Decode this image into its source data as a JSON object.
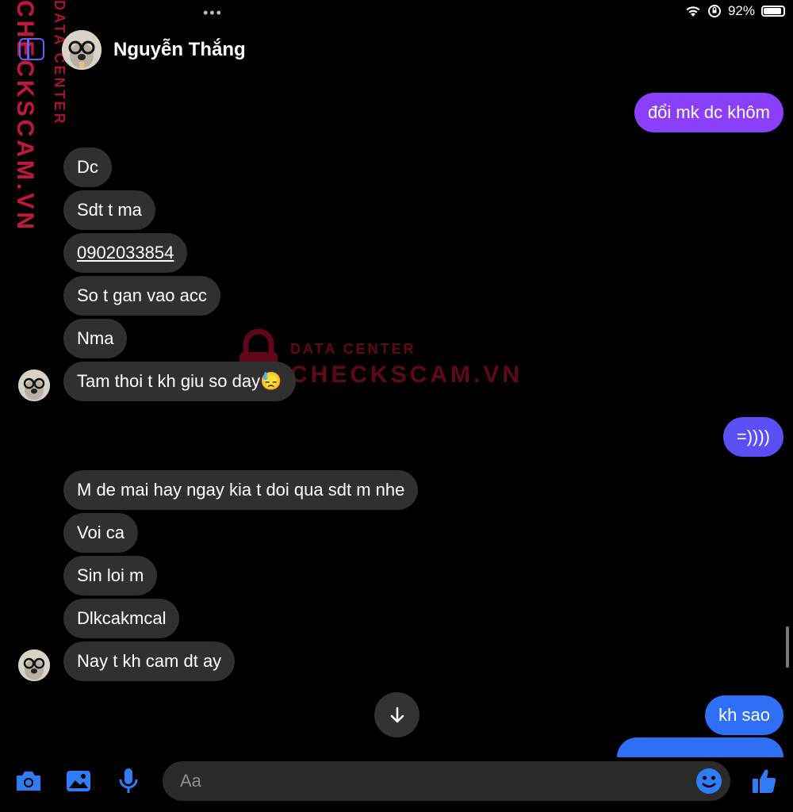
{
  "status_bar": {
    "dots": "•••",
    "battery_percent": "92%",
    "battery_level": 0.92
  },
  "header": {
    "contact_name": "Nguyễn Thắng"
  },
  "watermark": {
    "side_text": "CHECKSCAM.VN",
    "side_small_text": "DATA CENTER",
    "center_top": "DATA CENTER",
    "center_main": "CHECKSCAM.VN"
  },
  "messages": [
    {
      "side": "out",
      "text": "đổi mk dc khôm"
    },
    {
      "side": "in",
      "text": "Dc"
    },
    {
      "side": "in",
      "text": "Sdt t ma"
    },
    {
      "side": "in",
      "text": "0902033854"
    },
    {
      "side": "in",
      "text": "So t gan vao acc"
    },
    {
      "side": "in",
      "text": "Nma"
    },
    {
      "side": "in",
      "text": "Tam thoi t kh giu so day😓"
    },
    {
      "side": "out",
      "text": "=))))"
    },
    {
      "side": "in",
      "text": "M de mai hay ngay kia t doi qua sdt m nhe"
    },
    {
      "side": "in",
      "text": "Voi ca"
    },
    {
      "side": "in",
      "text": "Sin loi m"
    },
    {
      "side": "in",
      "text": "Dlkcakmcal"
    },
    {
      "side": "in",
      "text": "Nay t kh cam dt ay"
    },
    {
      "side": "out",
      "text": "kh sao"
    }
  ],
  "composer": {
    "placeholder": "Aa"
  },
  "icons": {
    "camera": "camera-icon",
    "gallery": "image-icon",
    "mic": "microphone-icon",
    "emoji": "emoji-icon",
    "like": "thumbs-up-icon",
    "scroll": "arrow-down-icon"
  },
  "colors": {
    "accent": "#2f7cf6",
    "incoming_bubble": "#303030",
    "outgoing_top": "#8a3ffc",
    "outgoing_mid": "#5a4ff5",
    "outgoing_bottom": "#2f6ff5"
  }
}
